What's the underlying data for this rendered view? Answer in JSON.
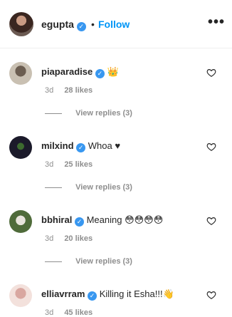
{
  "header": {
    "username": "egupta",
    "separator": "•",
    "follow_label": "Follow",
    "more_icon": "more-horizontal-icon"
  },
  "comments": [
    {
      "username": "piaparadise",
      "verified": true,
      "text": "👑",
      "time": "3d",
      "likes": "28 likes",
      "replies": "View replies (3)"
    },
    {
      "username": "milxind",
      "verified": true,
      "text": "Whoa ♥",
      "time": "3d",
      "likes": "25 likes",
      "replies": "View replies (3)"
    },
    {
      "username": "bbhiral",
      "verified": true,
      "text": "Meaning 😳😳😳😳",
      "time": "3d",
      "likes": "20 likes",
      "replies": "View replies (3)"
    },
    {
      "username": "elliavrram",
      "verified": true,
      "text": "Killing it Esha!!!👋",
      "time": "3d",
      "likes": "45 likes"
    }
  ],
  "colors": {
    "link_blue": "#0095f6",
    "verified_blue": "#3897f0",
    "meta_gray": "#8e8e8e"
  }
}
